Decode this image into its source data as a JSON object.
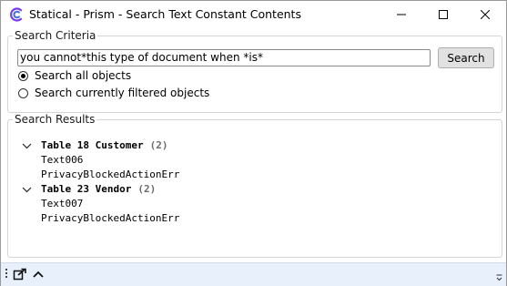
{
  "window": {
    "title": "Statical - Prism - Search Text Constant Contents",
    "app_icon": "prism-c-logo",
    "controls": [
      "minimize-icon",
      "maximize-icon",
      "close-icon"
    ]
  },
  "criteria": {
    "legend": "Search Criteria",
    "search_value": "you cannot*this type of document when *is*",
    "search_button_label": "Search",
    "radio_all_label": "Search all objects",
    "radio_filtered_label": "Search currently filtered objects",
    "selected": "all"
  },
  "results": {
    "legend": "Search Results",
    "nodes": [
      {
        "label": "Table 18 Customer",
        "count": "(2)",
        "children": [
          "Text006",
          "PrivacyBlockedActionErr"
        ]
      },
      {
        "label": "Table 23 Vendor",
        "count": "(2)",
        "children": [
          "Text007",
          "PrivacyBlockedActionErr"
        ]
      }
    ]
  },
  "toolbar": {
    "icons": [
      "drag-grip-icon",
      "export-icon",
      "collapse-up-icon",
      "overflow-icon"
    ]
  },
  "colors": {
    "accent": "#7b3fe4",
    "bottombar_bg": "#e8f0fb",
    "count_text": "#6b6b6b"
  }
}
